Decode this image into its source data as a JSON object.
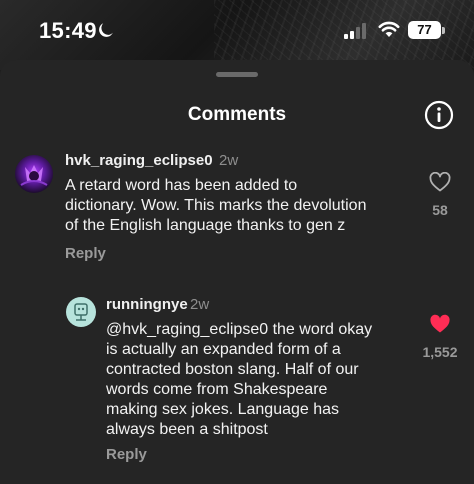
{
  "status_bar": {
    "time": "15:49",
    "battery": "77",
    "moon_icon": "moon-icon",
    "signal_icon": "cellular-signal-icon",
    "wifi_icon": "wifi-icon"
  },
  "sheet": {
    "title": "Comments",
    "info_icon": "info-icon"
  },
  "comments": [
    {
      "username": "hvk_raging_eclipse0",
      "time": "2w",
      "text_lines": [
        "A retard word has been added to",
        "dictionary. Wow. This marks the devolution",
        "of the English language thanks to gen z"
      ],
      "reply_label": "Reply",
      "likes": "58",
      "liked": false
    },
    {
      "username": "runningnye",
      "time": "2w",
      "mention": "@hvk_raging_eclipse0",
      "text_lines": [
        " the word okay",
        "is actually an expanded form of a",
        "contracted boston slang. Half of our",
        "words come from Shakespeare",
        "making sex jokes. Language has",
        "always been a shitpost"
      ],
      "reply_label": "Reply",
      "likes": "1,552",
      "liked": true
    }
  ],
  "colors": {
    "sheet_bg": "#252525",
    "liked_heart": "#ff2d55",
    "muted_text": "#8e8e8e"
  }
}
